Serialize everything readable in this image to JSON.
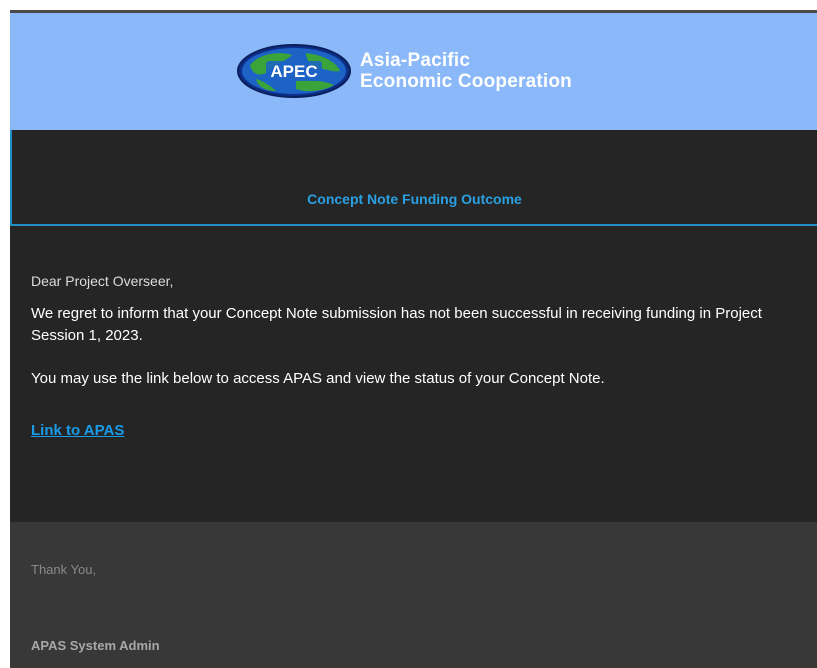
{
  "header": {
    "logo_badge": "APEC",
    "org_line1": "Asia-Pacific",
    "org_line2": "Economic Cooperation",
    "banner_color": "#8ab8f8"
  },
  "email": {
    "subject_heading": "Concept Note Funding Outcome",
    "greeting": "Dear Project Overseer,",
    "paragraph1": "We regret to inform that your Concept Note submission has not been successful in receiving funding in Project Session 1, 2023.",
    "paragraph2": "You may use the link below to access APAS and view the status of your Concept Note.",
    "link_label": "Link to APAS",
    "link_color": "#1a9be8",
    "heading_color": "#2aa0e0"
  },
  "footer": {
    "thanks": "Thank You,",
    "signature": "APAS System Admin"
  }
}
